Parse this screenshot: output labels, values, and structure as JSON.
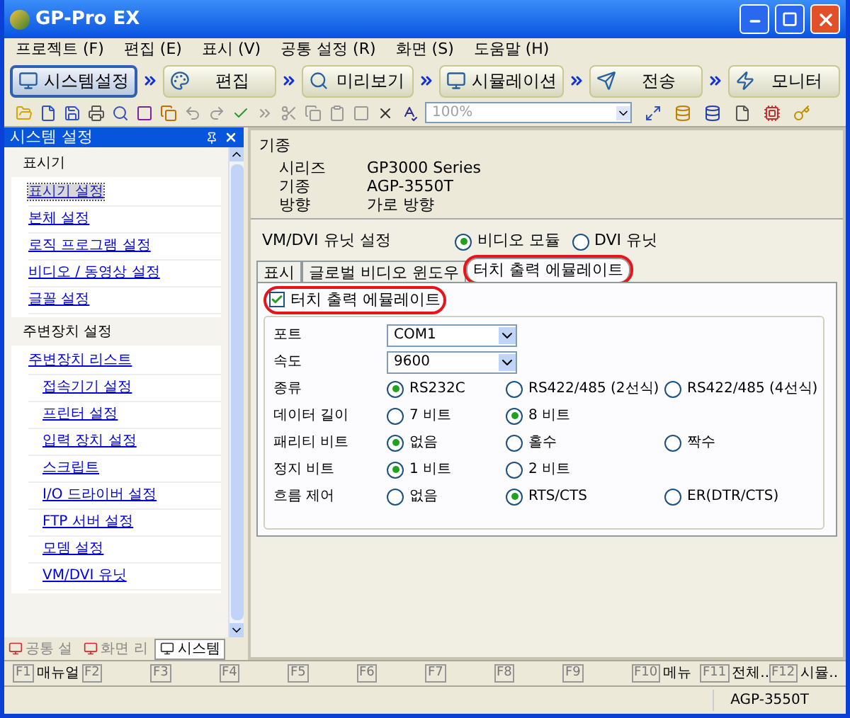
{
  "window": {
    "title": "GP-Pro EX"
  },
  "menu": [
    "프로젝트 (F)",
    "편집 (E)",
    "표시 (V)",
    "공통 설정 (R)",
    "화면 (S)",
    "도움말 (H)"
  ],
  "workflow": [
    {
      "label": "시스템설정",
      "selected": true
    },
    {
      "label": "편집",
      "selected": false
    },
    {
      "label": "미리보기",
      "selected": false
    },
    {
      "label": "시뮬레이션",
      "selected": false
    },
    {
      "label": "전송",
      "selected": false
    },
    {
      "label": "모니터",
      "selected": false
    }
  ],
  "toolbar": {
    "zoom": "100%"
  },
  "sidebar": {
    "title": "시스템 설정",
    "sections": [
      {
        "heading": "표시기",
        "items": [
          {
            "label": "표시기 설정",
            "selected": true
          },
          {
            "label": "본체 설정",
            "selected": false
          },
          {
            "label": "로직 프로그램 설정",
            "selected": false
          },
          {
            "label": "비디오 / 동영상 설정",
            "selected": false
          },
          {
            "label": "글꼴 설정",
            "selected": false
          }
        ]
      },
      {
        "heading": "주변장치 설정",
        "items": [
          {
            "label": "주변장치 리스트",
            "selected": false,
            "children": [
              {
                "label": "접속기기 설정",
                "selected": false
              },
              {
                "label": "프린터 설정",
                "selected": false
              },
              {
                "label": "입력 장치 설정",
                "selected": false
              },
              {
                "label": "스크립트",
                "selected": false
              },
              {
                "label": "I/O 드라이버 설정",
                "selected": false
              },
              {
                "label": "FTP 서버 설정",
                "selected": false
              },
              {
                "label": "모뎀 설정",
                "selected": false
              },
              {
                "label": "VM/DVI 유닛",
                "selected": false
              }
            ]
          }
        ]
      }
    ],
    "tabs": [
      {
        "label": "공통 설",
        "selected": false
      },
      {
        "label": "화면 리",
        "selected": false
      },
      {
        "label": "시스템",
        "selected": true
      }
    ]
  },
  "model": {
    "heading": "기종",
    "rows": [
      {
        "label": "시리즈",
        "value": "GP3000 Series"
      },
      {
        "label": "기종",
        "value": "AGP-3550T"
      },
      {
        "label": "방향",
        "value": "가로 방향"
      }
    ]
  },
  "unit": {
    "label": "VM/DVI 유닛 설정",
    "options": [
      {
        "label": "비디오 모듈",
        "selected": true
      },
      {
        "label": "DVI 유닛",
        "selected": false
      }
    ]
  },
  "tabs": [
    {
      "label": "표시",
      "selected": false,
      "highlighted": false
    },
    {
      "label": "글로벌 비디오 윈도우",
      "selected": false,
      "highlighted": false
    },
    {
      "label": "터치 출력 에뮬레이트",
      "selected": true,
      "highlighted": true
    }
  ],
  "emulate": {
    "label": "터치 출력 에뮬레이트",
    "checked": true,
    "highlighted": true
  },
  "settings": [
    {
      "kind": "select",
      "label": "포트",
      "value": "COM1"
    },
    {
      "kind": "select",
      "label": "속도",
      "value": "9600"
    },
    {
      "kind": "radio",
      "label": "종류",
      "options": [
        {
          "label": "RS232C",
          "selected": true
        },
        {
          "label": "RS422/485 (2선식)",
          "selected": false
        },
        {
          "label": "RS422/485 (4선식)",
          "selected": false
        }
      ]
    },
    {
      "kind": "radio",
      "label": "데이터 길이",
      "options": [
        {
          "label": "7 비트",
          "selected": false
        },
        {
          "label": "8 비트",
          "selected": true
        }
      ]
    },
    {
      "kind": "radio",
      "label": "패리티 비트",
      "options": [
        {
          "label": "없음",
          "selected": true
        },
        {
          "label": "홀수",
          "selected": false
        },
        {
          "label": "짝수",
          "selected": false
        }
      ]
    },
    {
      "kind": "radio",
      "label": "정지 비트",
      "options": [
        {
          "label": "1 비트",
          "selected": true
        },
        {
          "label": "2 비트",
          "selected": false
        }
      ]
    },
    {
      "kind": "radio",
      "label": "흐름 제어",
      "options": [
        {
          "label": "없음",
          "selected": false
        },
        {
          "label": "RTS/CTS",
          "selected": true
        },
        {
          "label": "ER(DTR/CTS)",
          "selected": false
        }
      ]
    }
  ],
  "function_keys": [
    {
      "key": "F1",
      "label": "매뉴얼"
    },
    {
      "key": "F2"
    },
    {
      "key": "F3"
    },
    {
      "key": "F4"
    },
    {
      "key": "F5"
    },
    {
      "key": "F6"
    },
    {
      "key": "F7"
    },
    {
      "key": "F8"
    },
    {
      "key": "F9"
    },
    {
      "key": "F10",
      "label": "메뉴"
    },
    {
      "key": "F11",
      "label": "전체.."
    },
    {
      "key": "F12",
      "label": "시뮬.."
    }
  ],
  "status_bar": {
    "model": "AGP-3550T"
  }
}
